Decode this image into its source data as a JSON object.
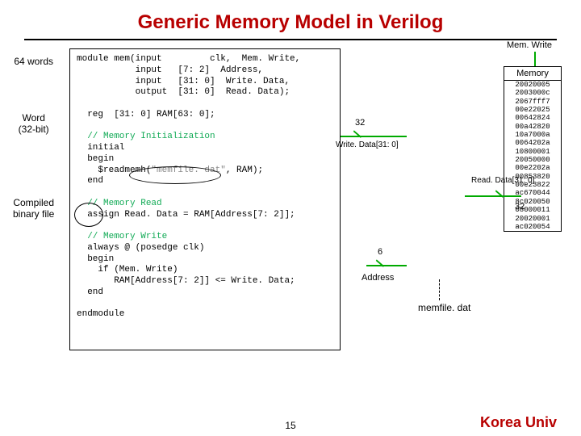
{
  "title": "Generic Memory Model in Verilog",
  "left_labels": {
    "words": "64 words",
    "word_a": "Word",
    "word_b": "(32-bit)",
    "comp_a": "Compiled",
    "comp_b": "binary file"
  },
  "code": {
    "l1a": "module mem(input         clk,  Mem. Write,",
    "l2": "           input   [7: 2]  Address,",
    "l3": "           input   [31: 0]  Write. Data,",
    "l4": "           output  [31: 0]  Read. Data);",
    "l5": "",
    "l6": "  reg  [31: 0] RAM[63: 0];",
    "l7": "",
    "l8c": "  // Memory Initialization",
    "l9": "  initial",
    "l10": "  begin",
    "l11a": "    $readmemh(",
    "l11s": "\"memfile. dat\"",
    "l11b": ", RAM);",
    "l12": "  end",
    "l13": "",
    "l14c": "  // Memory Read",
    "l15": "  assign Read. Data = RAM[Address[7: 2]];",
    "l16": "",
    "l17c": "  // Memory Write",
    "l18": "  always @ (posedge clk)",
    "l19": "  begin",
    "l20": "    if (Mem. Write)",
    "l21": "       RAM[Address[7: 2]] <= Write. Data;",
    "l22": "  end",
    "l23": "",
    "l24": "endmodule"
  },
  "signals": {
    "memwrite": "Mem. Write",
    "memory": "Memory",
    "writedata": "Write. Data[31: 0]",
    "readdata": "Read. Data[31: 0]",
    "address": "Address",
    "b32a": "32",
    "b32b": "32",
    "b6": "6",
    "memfile": "memfile. dat"
  },
  "memvals": [
    "20020005",
    "2003000c",
    "2067fff7",
    "00e22025",
    "00642824",
    "00a42820",
    "10a7000a",
    "0064202a",
    "10800001",
    "20050000",
    "00e2202a",
    "00853820",
    "00e23822",
    "ac670044",
    "8c020050",
    "08000011",
    "20020001",
    "ac020054"
  ],
  "pagenum": "15",
  "brand": "Korea Univ"
}
